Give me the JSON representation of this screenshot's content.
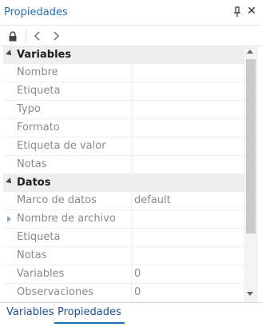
{
  "panel": {
    "title": "Propiedades",
    "pin_icon": "pin-icon",
    "close_label": "✕"
  },
  "toolbar": {
    "lock_icon": "lock-icon",
    "back_icon": "chevron-left-icon",
    "forward_icon": "chevron-right-icon"
  },
  "categories": {
    "variables": {
      "label": "Variables",
      "rows": [
        {
          "name": "Nombre",
          "value": ""
        },
        {
          "name": "Etiqueta",
          "value": ""
        },
        {
          "name": "Typo",
          "value": ""
        },
        {
          "name": "Formato",
          "value": ""
        },
        {
          "name": "Etiqueta de valor",
          "value": ""
        },
        {
          "name": "Notas",
          "value": ""
        }
      ]
    },
    "datos": {
      "label": "Datos",
      "rows": [
        {
          "name": "Marco de datos",
          "value": "default"
        },
        {
          "name": "Nombre de archivo",
          "value": ""
        },
        {
          "name": "Etiqueta",
          "value": ""
        },
        {
          "name": "Notas",
          "value": ""
        },
        {
          "name": "Variables",
          "value": "0"
        },
        {
          "name": "Observaciones",
          "value": "0"
        }
      ]
    }
  },
  "tabs": [
    {
      "label": "Variables",
      "active": false
    },
    {
      "label": "Propiedades",
      "active": true
    }
  ]
}
